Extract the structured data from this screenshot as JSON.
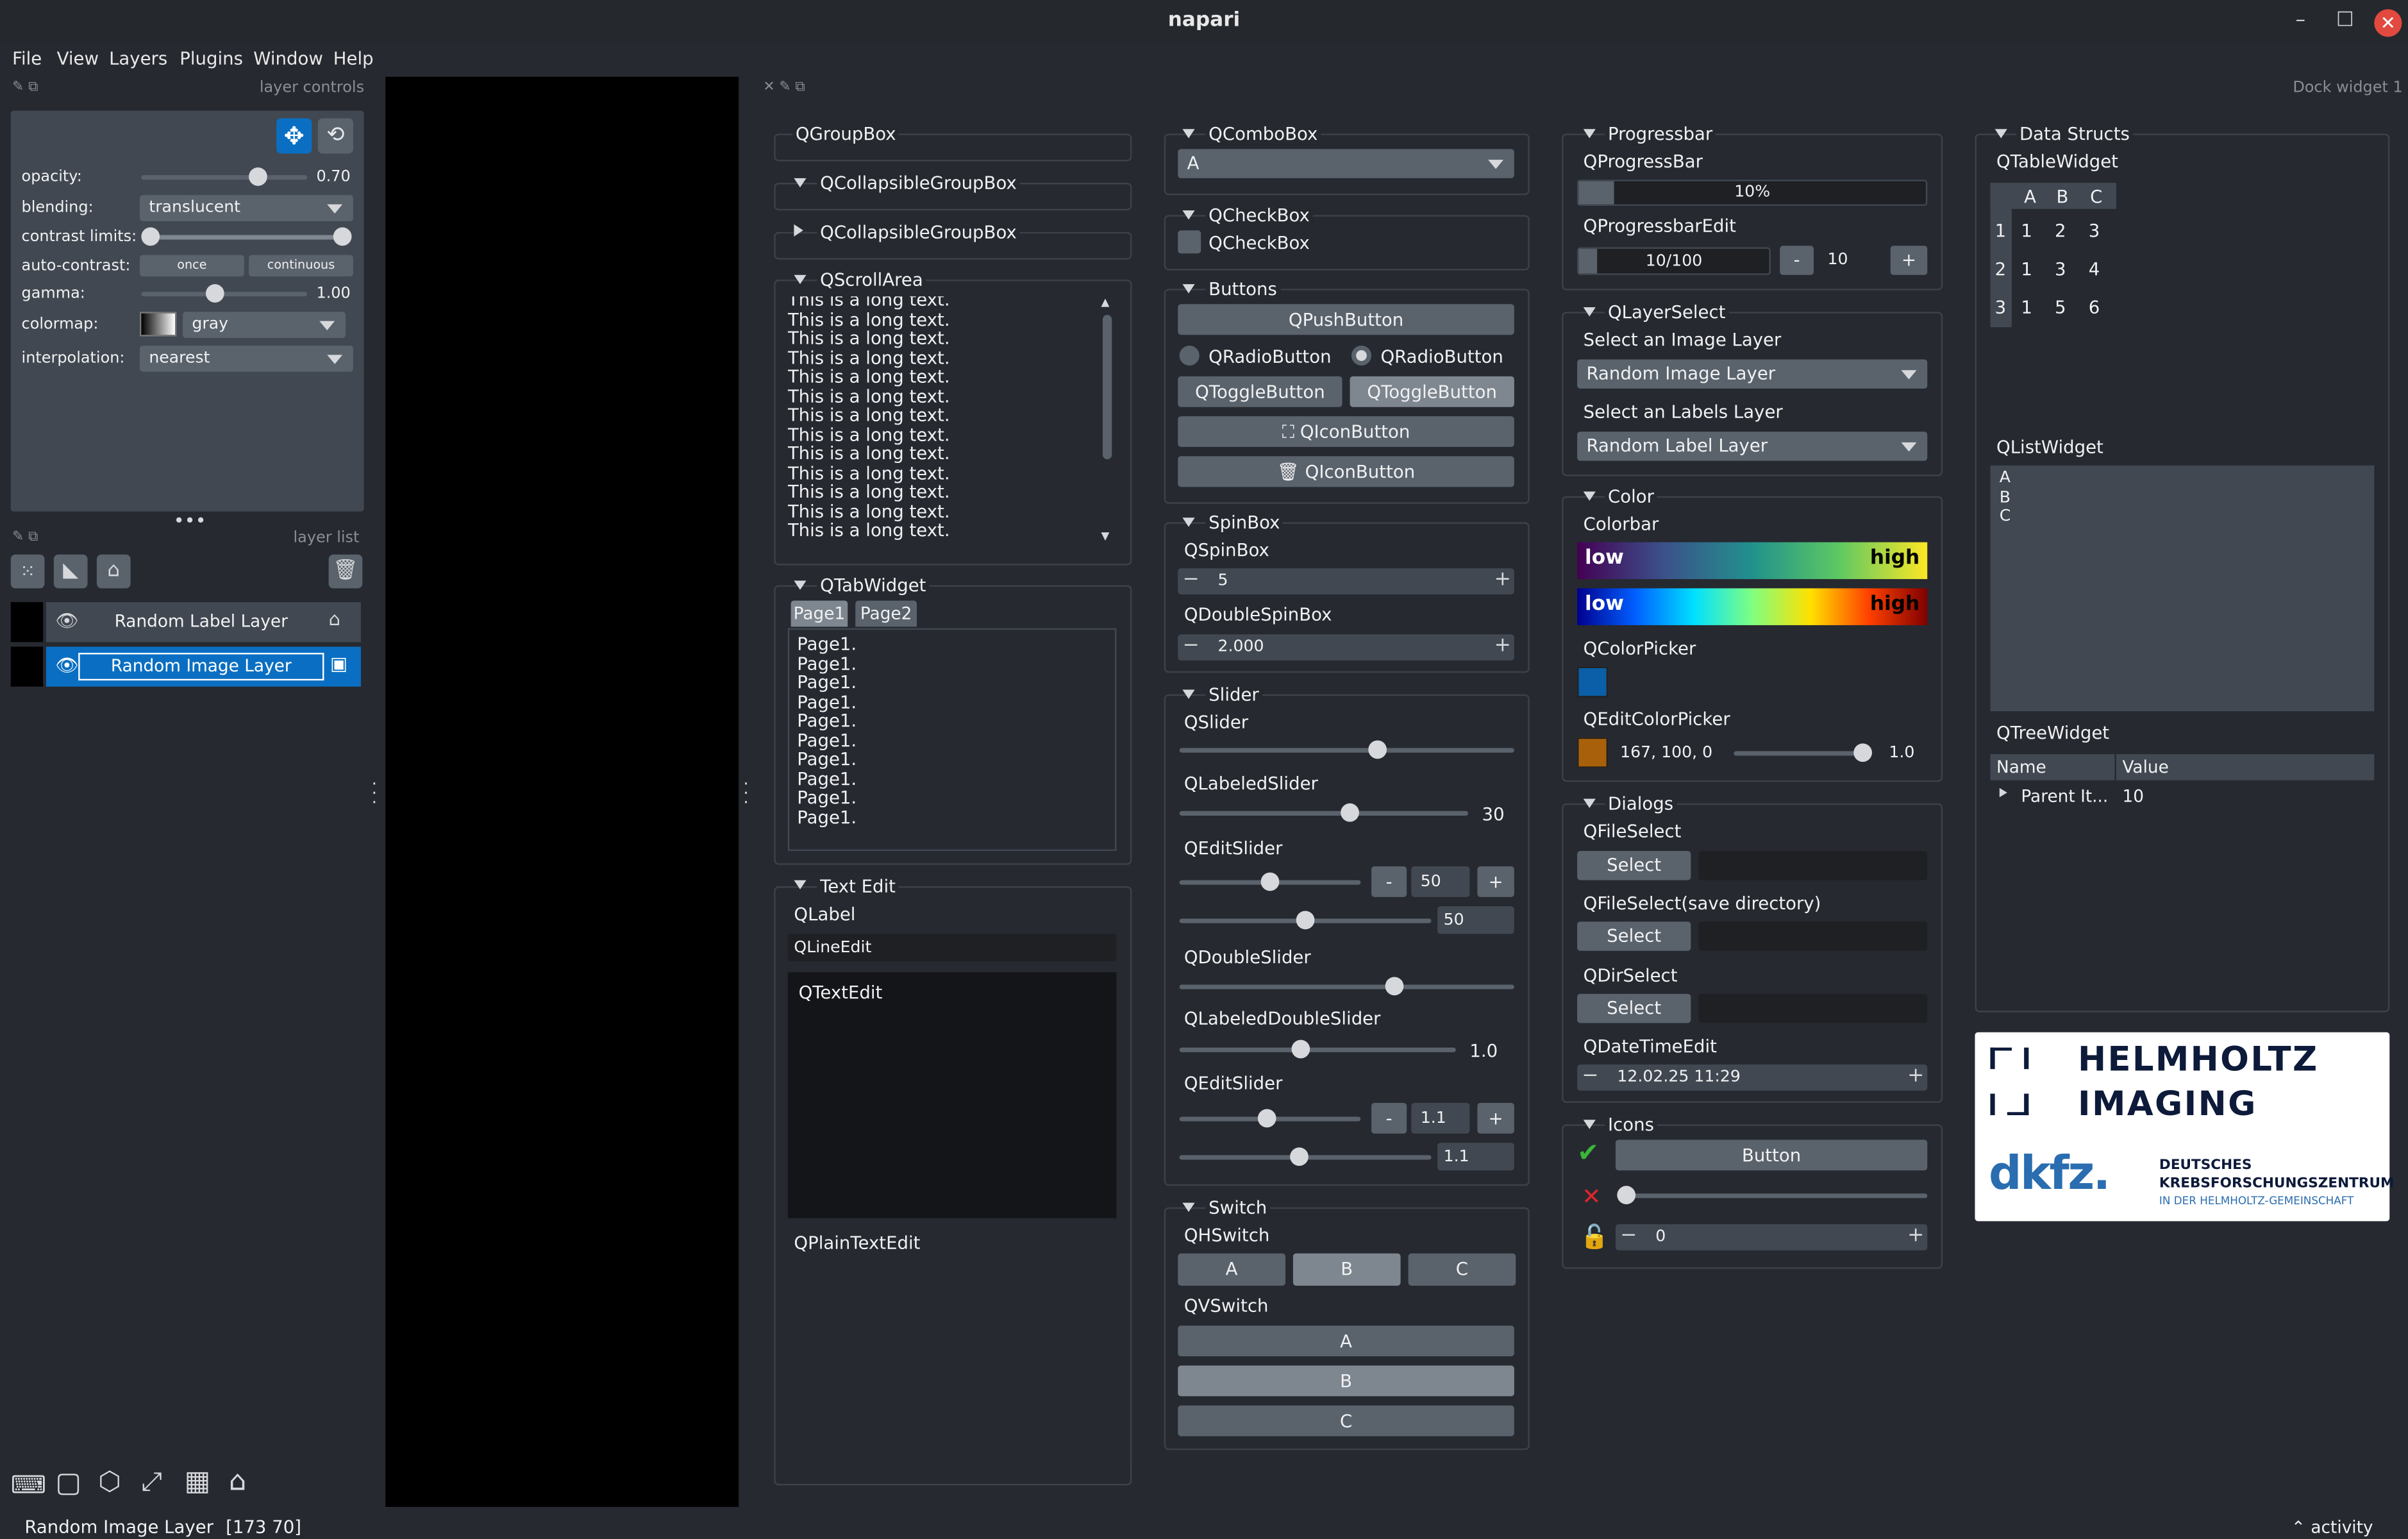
{
  "window": {
    "title": "napari",
    "minimize": "–",
    "maximize": "☐",
    "close": "✕"
  },
  "menu": [
    "File",
    "View",
    "Layers",
    "Plugins",
    "Window",
    "Help"
  ],
  "layer_controls": {
    "title": "layer controls",
    "opacity_label": "opacity:",
    "opacity_value": "0.70",
    "opacity_fraction": 0.7,
    "blending_label": "blending:",
    "blending_value": "translucent",
    "contrast_label": "contrast limits:",
    "auto_contrast_label": "auto-contrast:",
    "once": "once",
    "continuous": "continuous",
    "gamma_label": "gamma:",
    "gamma_value": "1.00",
    "colormap_label": "colormap:",
    "colormap_value": "gray",
    "interpolation_label": "interpolation:",
    "interpolation_value": "nearest"
  },
  "layer_list": {
    "title": "layer list",
    "layers": [
      {
        "name": "Random Label Layer",
        "type": "labels",
        "selected": false
      },
      {
        "name": "Random Image Layer",
        "type": "image",
        "selected": true
      }
    ]
  },
  "status": {
    "layer": "Random Image Layer",
    "coords": "[173 70]",
    "activity": "activity"
  },
  "dock": {
    "title": "Dock widget 1"
  },
  "col1": {
    "groupbox": "QGroupBox",
    "collapsible1": "QCollapsibleGroupBox",
    "collapsible2": "QCollapsibleGroupBox",
    "scrollarea": "QScrollArea",
    "long_text": [
      "This is a long text.",
      "This is a long text.",
      "This is a long text.",
      "This is a long text.",
      "This is a long text.",
      "This is a long text.",
      "This is a long text.",
      "This is a long text.",
      "This is a long text.",
      "This is a long text.",
      "This is a long text.",
      "This is a long text.",
      "This is a long text."
    ],
    "tabwidget": "QTabWidget",
    "tabs": [
      "Page1",
      "Page2"
    ],
    "page_lines": [
      "Page1.",
      "Page1.",
      "Page1.",
      "Page1.",
      "Page1.",
      "Page1.",
      "Page1.",
      "Page1.",
      "Page1.",
      "Page1."
    ],
    "textedit_group": "Text Edit",
    "qlabel": "QLabel",
    "qlineedit": "QLineEdit",
    "qtextedit": "QTextEdit",
    "qplaintextedit": "QPlainTextEdit"
  },
  "col2": {
    "combobox_title": "QComboBox",
    "combobox_value": "A",
    "checkbox_title": "QCheckBox",
    "checkbox_label": "QCheckBox",
    "buttons_title": "Buttons",
    "pushbutton": "QPushButton",
    "radio1": "QRadioButton",
    "radio2": "QRadioButton",
    "toggle1": "QToggleButton",
    "toggle2": "QToggleButton",
    "iconbtn1": "QIconButton",
    "iconbtn2": "QIconButton",
    "spinbox_title": "SpinBox",
    "qspinbox": "QSpinBox",
    "spin_value": "5",
    "qdoublespinbox": "QDoubleSpinBox",
    "double_value": "2.000",
    "slider_title": "Slider",
    "qslider": "QSlider",
    "qlabeledslider": "QLabeledSlider",
    "labeled_value": "30",
    "qeditslider": "QEditSlider",
    "edit_value": "50",
    "edit_value2": "50",
    "qdoubleslider": "QDoubleSlider",
    "qlabeleddoubleslider": "QLabeledDoubleSlider",
    "labeled_double_value": "1.0",
    "qeditslider2": "QEditSlider",
    "edit2_value": "1.1",
    "edit2_value2": "1.1",
    "minus": "-",
    "plus": "+",
    "switch_title": "Switch",
    "qhswitch": "QHSwitch",
    "qvswitch": "QVSwitch",
    "switch_items": [
      "A",
      "B",
      "C"
    ]
  },
  "col3": {
    "progress_title": "Progressbar",
    "qprogressbar": "QProgressBar",
    "progress_text": "10%",
    "progress_fraction": 0.1,
    "qprogressbaredit": "QProgressbarEdit",
    "progress_edit_text": "10/100",
    "progress_edit_value": "10",
    "minus": "-",
    "plus": "+",
    "layerselect_title": "QLayerSelect",
    "select_image_label": "Select an Image Layer",
    "select_image_value": "Random Image Layer",
    "select_labels_label": "Select an Labels Layer",
    "select_labels_value": "Random Label Layer",
    "color_title": "Color",
    "colorbar": "Colorbar",
    "low": "low",
    "high": "high",
    "qcolorpicker": "QColorPicker",
    "picker_color": "#0a5fa8",
    "qeditcolorpicker": "QEditColorPicker",
    "edit_color": "#a8600a",
    "edit_color_text": "167, 100, 0",
    "edit_color_alpha": "1.0",
    "dialogs_title": "Dialogs",
    "qfileselect": "QFileSelect",
    "qfileselect_save": "QFileSelect(save directory)",
    "qdirselect": "QDirSelect",
    "select": "Select",
    "qdatetimeedit": "QDateTimeEdit",
    "datetime_value": "12.02.25 11:29",
    "icons_title": "Icons",
    "icons_button": "Button",
    "icons_spin_value": "0"
  },
  "col4": {
    "title": "Data Structs",
    "qtablewidget": "QTableWidget",
    "table_headers": [
      "A",
      "B",
      "C"
    ],
    "table_rows": [
      {
        "n": "1",
        "cells": [
          "1",
          "2",
          "3"
        ]
      },
      {
        "n": "2",
        "cells": [
          "1",
          "3",
          "4"
        ]
      },
      {
        "n": "3",
        "cells": [
          "1",
          "5",
          "6"
        ]
      }
    ],
    "qlistwidget": "QListWidget",
    "list_items": [
      "A",
      "B",
      "C"
    ],
    "qtreewidget": "QTreeWidget",
    "tree_headers": [
      "Name",
      "Value"
    ],
    "tree_row": {
      "name": "Parent It...",
      "value": "10"
    }
  },
  "logo": {
    "line1": "HELMHOLTZ",
    "line2": "IMAGING",
    "dkfz": "dkfz.",
    "dk1": "DEUTSCHES",
    "dk2": "KREBSFORSCHUNGSZENTRUM",
    "dk3": "IN DER HELMHOLTZ-GEMEINSCHAFT"
  }
}
